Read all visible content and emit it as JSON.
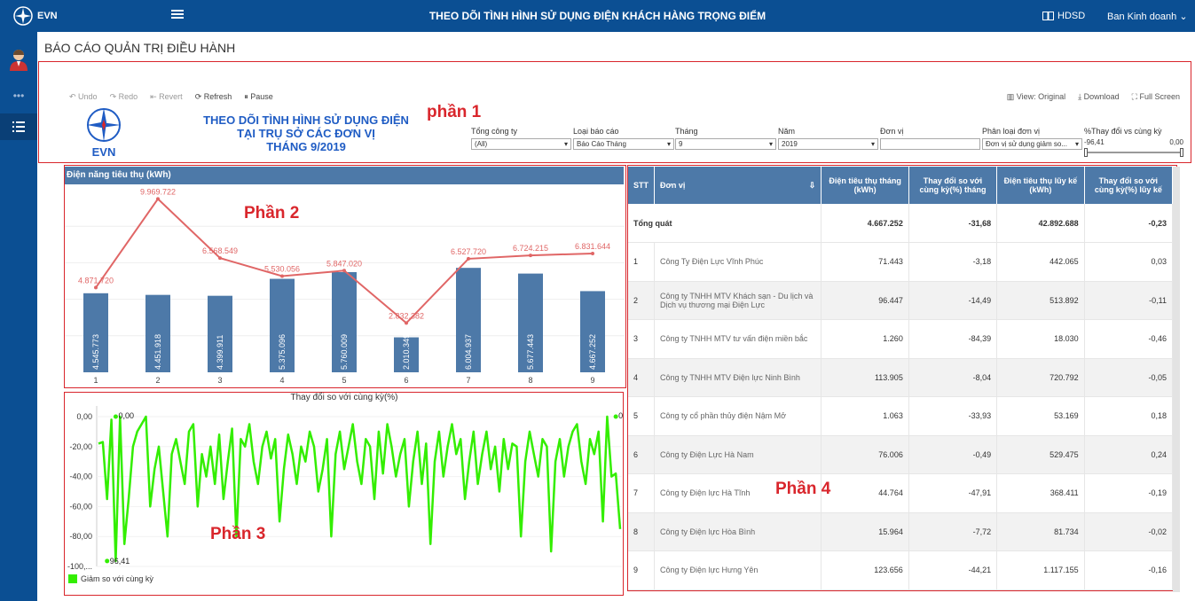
{
  "header": {
    "logo_text": "EVN",
    "title": "THEO DÕI TÌNH HÌNH SỬ DỤNG ĐIỆN KHÁCH HÀNG TRỌNG ĐIỂM",
    "help_label": "HDSD",
    "user_menu": "Ban Kinh doanh"
  },
  "page": {
    "title": "BÁO CÁO QUẢN TRỊ ĐIỀU HÀNH"
  },
  "toolbar": {
    "undo": "Undo",
    "redo": "Redo",
    "revert": "Revert",
    "refresh": "Refresh",
    "pause": "Pause",
    "view": "View: Original",
    "download": "Download",
    "fullscreen": "Full Screen"
  },
  "dashboard": {
    "logo_text": "EVN",
    "title_line1": "THEO DÕI TÌNH HÌNH SỬ DỤNG ĐIỆN",
    "title_line2": "TẠI TRỤ SỞ CÁC ĐƠN VỊ",
    "title_line3": "THÁNG 9/2019"
  },
  "filters": {
    "company_label": "Tổng công ty",
    "company_value": "(All)",
    "report_label": "Loại báo cáo",
    "report_value": "Báo Cáo Tháng",
    "month_label": "Tháng",
    "month_value": "9",
    "year_label": "Năm",
    "year_value": "2019",
    "unit_label": "Đơn vị",
    "unit_value": "",
    "unit_type_label": "Phân loại đơn vị",
    "unit_type_value": "Đơn vị sử dụng giảm so...",
    "change_label": "%Thay đổi vs cùng kỳ",
    "change_min": "-96,41",
    "change_max": "0,00"
  },
  "annotations": {
    "part1": "phần 1",
    "part2": "Phần 2",
    "part3": "Phần 3",
    "part4": "Phần 4"
  },
  "chart_data": [
    {
      "type": "bar",
      "title": "Điện năng tiêu thụ (kWh)",
      "categories": [
        "1",
        "2",
        "3",
        "4",
        "5",
        "6",
        "7",
        "8",
        "9"
      ],
      "series": [
        {
          "values": [
            4545773,
            4451918,
            4399911,
            5375096,
            5760009,
            2010349,
            6004937,
            5677443,
            4667252
          ],
          "labels": [
            "4.545.773",
            "4.451.918",
            "4.399.911",
            "5.375.096",
            "5.760.009",
            "2.010.349",
            "6.004.937",
            "5.677.443",
            "4.667.252"
          ]
        },
        {
          "values": [
            4871720,
            9969722,
            6568549,
            5530000,
            5847020,
            2832382,
            6527720,
            6724215,
            6831644
          ],
          "labels": [
            "4.871.720",
            "9.969.722",
            "6.568.549",
            "5.530.056",
            "5.847.020",
            "2.832.382",
            "6.527.720",
            "6.724.215",
            "6.831.644"
          ]
        }
      ],
      "colors": [
        "#4d79a8",
        "#e06666"
      ]
    },
    {
      "type": "line",
      "title": "Thay đổi so với cùng kỳ(%)",
      "yticks": [
        "0,00",
        "-20,00",
        "-40,00",
        "-60,00",
        "-80,00",
        "-100,..."
      ],
      "ylim": [
        -100,
        0
      ],
      "legend": "Giảm so với cùng kỳ",
      "color": "#33ee00",
      "annotations": [
        {
          "x": 4,
          "y": 0,
          "label": "0,00"
        },
        {
          "x": 2,
          "y": -96.41,
          "label": "96,41"
        },
        {
          "x": 120,
          "y": 0,
          "label": "0,00"
        }
      ],
      "values": [
        -18,
        -17,
        -55,
        -2,
        -96.41,
        0,
        -85,
        -55,
        -20,
        -10,
        -5,
        0,
        -60,
        -35,
        -20,
        -50,
        -80,
        -25,
        -15,
        -30,
        -45,
        -10,
        -5,
        -60,
        -25,
        -40,
        -20,
        -45,
        -12,
        -55,
        -30,
        -8,
        -80,
        -15,
        -20,
        -5,
        -30,
        -45,
        -20,
        -10,
        -28,
        -15,
        -70,
        -35,
        -12,
        -25,
        -45,
        -20,
        -30,
        -10,
        -20,
        -50,
        -35,
        -15,
        -80,
        -25,
        -10,
        -35,
        -20,
        -5,
        -30,
        -45,
        -15,
        -20,
        -55,
        -10,
        -38,
        -5,
        -20,
        -40,
        -25,
        -15,
        -60,
        -30,
        -10,
        -45,
        -18,
        -85,
        -30,
        -10,
        -40,
        -20,
        -5,
        -25,
        -15,
        -55,
        -30,
        -10,
        -45,
        -25,
        -10,
        -35,
        -20,
        -50,
        -15,
        -35,
        -18,
        -20,
        -80,
        -30,
        -10,
        -25,
        -40,
        -15,
        -20,
        -90,
        -30,
        -15,
        -40,
        -20,
        -10,
        -5,
        -30,
        -45,
        -15,
        -25,
        -10,
        -70,
        0,
        -40,
        -38,
        -75
      ]
    }
  ],
  "table": {
    "columns": [
      "STT",
      "Đơn vị",
      "Điện tiêu thụ tháng (kWh)",
      "Thay đổi so với cùng kỳ(%) tháng",
      "Điện tiêu thụ lũy kế (kWh)",
      "Thay đổi so với cùng kỳ(%) lũy kế"
    ],
    "total": {
      "label": "Tổng quát",
      "month": "4.667.252",
      "month_change": "-31,68",
      "cumulative": "42.892.688",
      "cumulative_change": "-0,23"
    },
    "rows": [
      {
        "stt": "1",
        "name": "Công Ty Điện Lực Vĩnh Phúc",
        "month": "71.443",
        "month_change": "-3,18",
        "cumulative": "442.065",
        "cumulative_change": "0,03"
      },
      {
        "stt": "2",
        "name": "Công ty TNHH MTV Khách sạn - Du lịch và Dịch vụ thương mại Điện Lực",
        "month": "96.447",
        "month_change": "-14,49",
        "cumulative": "513.892",
        "cumulative_change": "-0,11"
      },
      {
        "stt": "3",
        "name": "Công ty TNHH MTV tư vấn điện miền bắc",
        "month": "1.260",
        "month_change": "-84,39",
        "cumulative": "18.030",
        "cumulative_change": "-0,46"
      },
      {
        "stt": "4",
        "name": "Công ty TNHH MTV Điện lực Ninh Bình",
        "month": "113.905",
        "month_change": "-8,04",
        "cumulative": "720.792",
        "cumulative_change": "-0,05"
      },
      {
        "stt": "5",
        "name": "Công ty cổ phần thủy điện Nậm Mở",
        "month": "1.063",
        "month_change": "-33,93",
        "cumulative": "53.169",
        "cumulative_change": "0,18"
      },
      {
        "stt": "6",
        "name": "Công ty Điện Lực Hà Nam",
        "month": "76.006",
        "month_change": "-0,49",
        "cumulative": "529.475",
        "cumulative_change": "0,24"
      },
      {
        "stt": "7",
        "name": "Công ty Điện lực Hà Tĩnh",
        "month": "44.764",
        "month_change": "-47,91",
        "cumulative": "368.411",
        "cumulative_change": "-0,19"
      },
      {
        "stt": "8",
        "name": "Công ty Điện lực Hòa Bình",
        "month": "15.964",
        "month_change": "-7,72",
        "cumulative": "81.734",
        "cumulative_change": "-0,02"
      },
      {
        "stt": "9",
        "name": "Công ty Điện lực Hưng Yên",
        "month": "123.656",
        "month_change": "-44,21",
        "cumulative": "1.117.155",
        "cumulative_change": "-0,16"
      }
    ]
  }
}
